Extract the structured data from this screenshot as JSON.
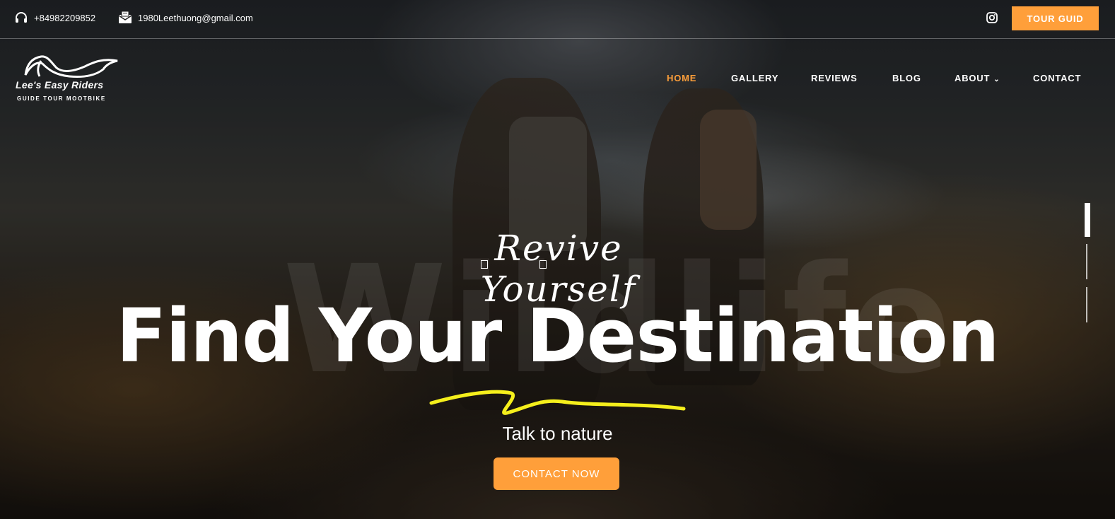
{
  "topbar": {
    "phone": "+84982209852",
    "email": "1980Leethuong@gmail.com",
    "tour_button": "TOUR GUID",
    "icons": [
      "headphones-icon",
      "envelope-icon",
      "instagram-icon"
    ]
  },
  "logo": {
    "title": "Lee's Easy Riders",
    "subtitle": "GUIDE TOUR MOOTBIKE"
  },
  "nav": {
    "items": [
      {
        "label": "HOME",
        "active": true
      },
      {
        "label": "GALLERY",
        "active": false
      },
      {
        "label": "REVIEWS",
        "active": false
      },
      {
        "label": "BLOG",
        "active": false
      },
      {
        "label": "ABOUT",
        "active": false,
        "dropdown": true
      },
      {
        "label": "CONTACT",
        "active": false
      }
    ]
  },
  "hero": {
    "script_title": "Revive Yourself",
    "watermark": "Wildlife",
    "title": "Find Your Destination",
    "subtitle": "Talk to nature",
    "cta": "CONTACT NOW",
    "slides": 3,
    "active_slide": 1
  },
  "colors": {
    "accent": "#ff9f3a",
    "squiggle": "#f5ef1c"
  }
}
